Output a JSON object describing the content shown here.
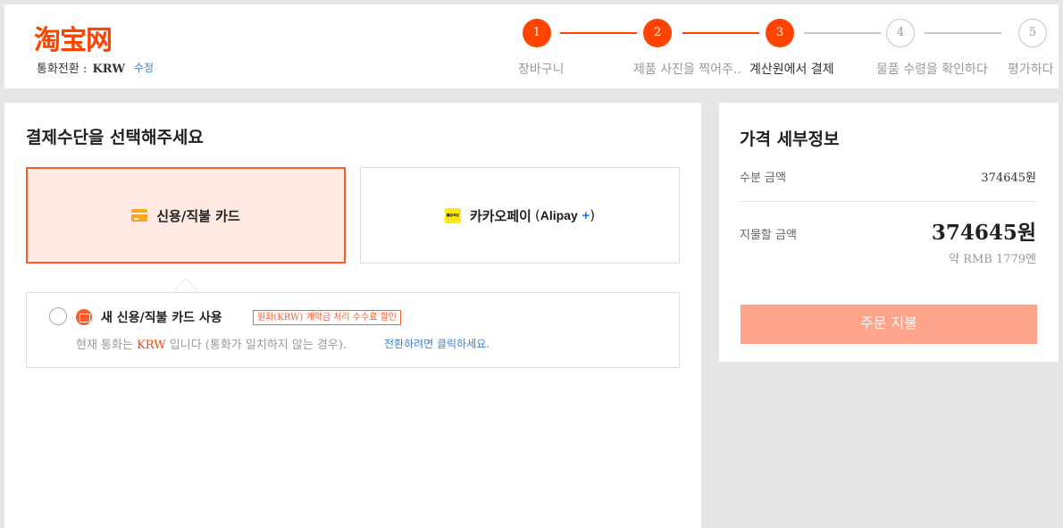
{
  "header": {
    "logo_text": "淘宝网",
    "currency_label": "통화전환 :",
    "currency_value": "KRW",
    "currency_edit": "수정"
  },
  "steps": [
    {
      "number": "1",
      "label": "장바구니",
      "status": "done"
    },
    {
      "number": "2",
      "label": "제품 사진을 찍어주..",
      "status": "done"
    },
    {
      "number": "3",
      "label": "계산원에서 결제",
      "status": "current"
    },
    {
      "number": "4",
      "label": "물품 수령을 확인하다",
      "status": "todo"
    },
    {
      "number": "5",
      "label": "평가하다",
      "status": "todo"
    }
  ],
  "payment": {
    "title": "결제수단을 선택해주세요",
    "options": [
      {
        "label": "신용/직불 카드",
        "icon": "credit-card-icon",
        "selected": true
      },
      {
        "label": "카카오페이",
        "paren_open": "(",
        "alipay": "Alipay",
        "alipay_plus": "+",
        "paren_close": ")",
        "icon": "kakaopay-icon",
        "icon_text": "●pay",
        "selected": false
      }
    ],
    "new_card_label": "새 신용/직불 카드 사용",
    "badge": "원화(KRW) 계약금 처리 수수료 할인",
    "note_prefix": "현재 통화는",
    "note_currency": "KRW",
    "note_suffix": "입니다 (통화가 일치하지 않는 경우).",
    "note_link": "전환하려면 클릭하세요."
  },
  "price": {
    "title": "가격 세부정보",
    "order_amount_label": "수분 금액",
    "order_amount_value": "374645원",
    "pay_amount_label": "지물할 금액",
    "pay_amount_value": "374645원",
    "rmb_approx": "약 RMB 1779엔",
    "pay_button": "주문 지불"
  },
  "colors": {
    "accent": "#ff4400",
    "selected_bg": "#ffe9e2",
    "pay_button": "#ffa38a",
    "link": "#3c82d8"
  }
}
